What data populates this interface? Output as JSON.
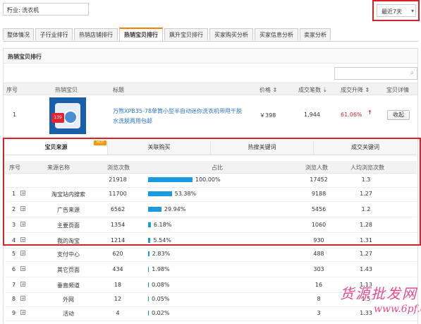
{
  "filters": {
    "industry_select": "行业: 洗衣机",
    "date_select": "最近7天"
  },
  "main_tabs": [
    {
      "label": "整体情况"
    },
    {
      "label": "子行业排行"
    },
    {
      "label": "热销店铺排行"
    },
    {
      "label": "热销宝贝排行"
    },
    {
      "label": "飙升宝贝排行"
    },
    {
      "label": "买家购买分析"
    },
    {
      "label": "买家信息分析"
    },
    {
      "label": "卖家分析"
    }
  ],
  "panel": {
    "title": "热销宝贝排行"
  },
  "table_headers": {
    "index": "序号",
    "product": "热销宝贝",
    "title": "标题",
    "price": "价格 ⇕",
    "deals": "成交笔数 ⇣",
    "trend": "成交升降 ⇕",
    "detail": "宝贝详情"
  },
  "product_row": {
    "index": "1",
    "thumb_badge": "139",
    "title": "万煦XPB35-78单筒小型半自动迷你洗衣机带甩干脱水洗脱两用包邮",
    "price": "￥398",
    "deals": "1,944",
    "trend": "61.06%",
    "trend_arrow": "↑",
    "collect": "收起"
  },
  "sub_tabs": [
    {
      "label": "宝贝来源"
    },
    {
      "label": "关联购买"
    },
    {
      "label": "热搜关键词"
    },
    {
      "label": "成交关键词"
    }
  ],
  "hot_badge": "HOT",
  "source_headers": {
    "index": "序号",
    "source": "来源名称",
    "visits": "浏览次数",
    "share": "占比",
    "visitors": "浏览人数",
    "per_person": "人均浏览次数"
  },
  "source_rows": [
    {
      "index": "",
      "source": "",
      "visits": "21918",
      "share": "100.00%",
      "share_value": 100.0,
      "visitors": "17452",
      "per_person": "1.3",
      "expand": false
    },
    {
      "index": "1",
      "source": "淘宝站内搜索",
      "visits": "11700",
      "share": "53.38%",
      "share_value": 53.38,
      "visitors": "9188",
      "per_person": "1.27",
      "expand": true
    },
    {
      "index": "2",
      "source": "广告来源",
      "visits": "6562",
      "share": "29.94%",
      "share_value": 29.94,
      "visitors": "5456",
      "per_person": "1.2",
      "expand": true
    },
    {
      "index": "3",
      "source": "主要页面",
      "visits": "1354",
      "share": "6.18%",
      "share_value": 6.18,
      "visitors": "1060",
      "per_person": "1.28",
      "expand": true
    },
    {
      "index": "4",
      "source": "我的淘宝",
      "visits": "1214",
      "share": "5.54%",
      "share_value": 5.54,
      "visitors": "930",
      "per_person": "1.31",
      "expand": true
    },
    {
      "index": "5",
      "source": "支付中心",
      "visits": "620",
      "share": "2.83%",
      "share_value": 2.83,
      "visitors": "488",
      "per_person": "1.27",
      "expand": true
    },
    {
      "index": "6",
      "source": "其它页面",
      "visits": "434",
      "share": "1.98%",
      "share_value": 1.98,
      "visitors": "303",
      "per_person": "1.43",
      "expand": true
    },
    {
      "index": "7",
      "source": "垂直频道",
      "visits": "18",
      "share": "0.08%",
      "share_value": 0.08,
      "visitors": "16",
      "per_person": "1.13",
      "expand": true
    },
    {
      "index": "8",
      "source": "外网",
      "visits": "12",
      "share": "0.05%",
      "share_value": 0.05,
      "visitors": "8",
      "per_person": "1.5",
      "expand": true
    },
    {
      "index": "9",
      "source": "活动",
      "visits": "4",
      "share": "0.02%",
      "share_value": 0.02,
      "visitors": "3",
      "per_person": "1.33",
      "expand": true
    }
  ],
  "watermark": {
    "line1": "货源批发网",
    "line2": "www.6pf.cn"
  },
  "colors": {
    "accent_orange": "#f08300",
    "highlight_red": "#d9202a",
    "bar_blue": "#1a9be0",
    "link_blue": "#2a78c8",
    "trend_red": "#e0262e"
  }
}
